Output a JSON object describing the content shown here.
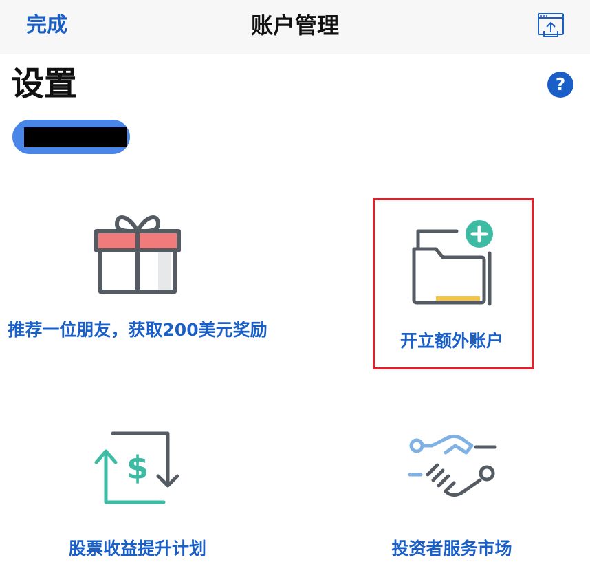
{
  "nav": {
    "done_label": "完成",
    "title": "账户管理",
    "share_icon": "share-window-icon"
  },
  "page": {
    "title": "设置",
    "help_label": "?"
  },
  "account": {
    "selector_icon": "account-pill"
  },
  "tiles": [
    {
      "label": "推荐一位朋友，获取200美元奖励",
      "icon": "gift-icon"
    },
    {
      "label": "开立额外账户",
      "icon": "folder-add-icon"
    },
    {
      "label": "股票收益提升计划",
      "icon": "stock-yield-icon"
    },
    {
      "label": "投资者服务市场",
      "icon": "handshake-icon"
    }
  ],
  "colors": {
    "accent": "#1a5fc7",
    "highlight": "#e0202a",
    "pill": "#4a86e8",
    "teal": "#3dbba3",
    "gift_red": "#f07b7b",
    "folder_yellow": "#f5c542"
  }
}
